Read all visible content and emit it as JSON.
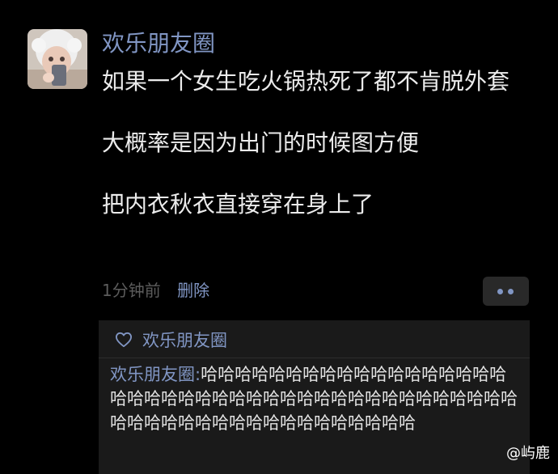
{
  "post": {
    "author": "欢乐朋友圈",
    "lines": [
      "如果一个女生吃火锅热死了都不肯脱外套",
      "",
      "大概率是因为出门的时候图方便",
      "",
      "把内衣秋衣直接穿在身上了"
    ],
    "time": "1分钟前",
    "delete_label": "删除"
  },
  "likes": {
    "icon": "heart-icon",
    "name": "欢乐朋友圈"
  },
  "comment": {
    "author": "欢乐朋友圈:",
    "text": "哈哈哈哈哈哈哈哈哈哈哈哈哈哈哈哈哈哈哈哈哈哈哈哈哈哈哈哈哈哈哈哈哈哈哈哈哈哈哈哈哈哈哈哈哈哈哈哈哈哈哈哈哈哈哈哈哈哈哈哈"
  },
  "watermark": "@屿鹿",
  "colors": {
    "background": "#000000",
    "link_blue": "#8196c4",
    "text": "#ececec",
    "muted": "#5c5c5c",
    "panel": "#1a1a1a"
  }
}
